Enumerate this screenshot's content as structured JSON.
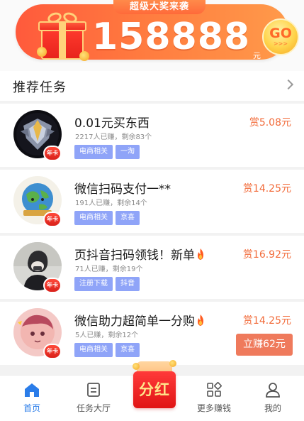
{
  "banner": {
    "tag": "超级大奖来袭",
    "amount": "158888",
    "unit": "元",
    "go_label": "GO",
    "go_arrows": ">>>"
  },
  "section": {
    "title": "推荐任务"
  },
  "tasks": [
    {
      "title": "0.01元买东西",
      "meta": "2217人已赚，剩余83个",
      "tags": [
        "电商相关",
        "一淘"
      ],
      "reward": "赏5.08元",
      "badge": "年卡",
      "button": null
    },
    {
      "title": "微信扫码支付一**",
      "meta": "191人已赚，剩余14个",
      "tags": [
        "电商相关",
        "京喜"
      ],
      "reward": "赏14.25元",
      "badge": "年卡",
      "button": null
    },
    {
      "title": "页抖音扫码领钱！新单",
      "meta": "71人已赚，剩余19个",
      "tags": [
        "注册下载",
        "抖音"
      ],
      "reward": "赏16.92元",
      "badge": "年卡",
      "button": null
    },
    {
      "title": "微信助力超简单一分购",
      "meta": "5人已赚，剩余12个",
      "tags": [
        "电商相关",
        "京喜"
      ],
      "reward": "赏14.25元",
      "badge": "年卡",
      "button": "立赚62元"
    }
  ],
  "tabbar": {
    "home": "首页",
    "tasks": "任务大厅",
    "center": "分红",
    "more": "更多赚钱",
    "mine": "我的"
  },
  "colors": {
    "accent": "#2b7de9",
    "reward": "#f26b3a",
    "tag_bg": "#8fa4f8",
    "banner": "#ff6a3a"
  }
}
